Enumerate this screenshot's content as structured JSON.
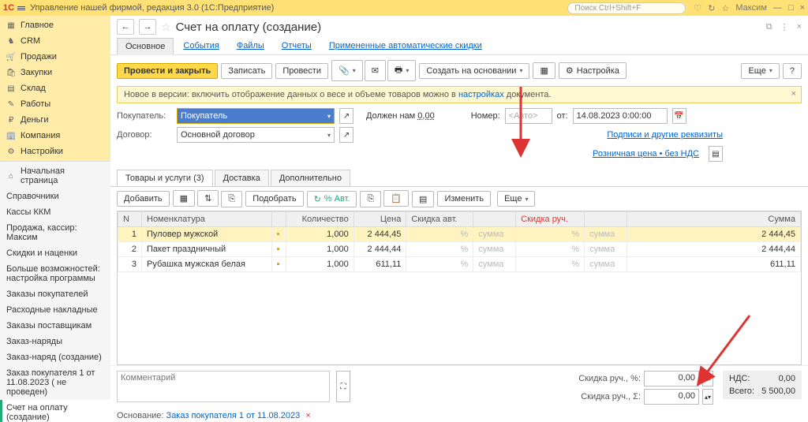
{
  "titlebar": {
    "title": "Управление нашей фирмой, редакция 3.0  (1С:Предприятие)",
    "search_ph": "Поиск Ctrl+Shift+F",
    "user": "Максим"
  },
  "sidebar": {
    "main": [
      {
        "icon": "▦",
        "label": "Главное"
      },
      {
        "icon": "♞",
        "label": "CRM"
      },
      {
        "icon": "🛒",
        "label": "Продажи"
      },
      {
        "icon": "🛍",
        "label": "Закупки"
      },
      {
        "icon": "▤",
        "label": "Склад"
      },
      {
        "icon": "✎",
        "label": "Работы"
      },
      {
        "icon": "₽",
        "label": "Деньги"
      },
      {
        "icon": "🏢",
        "label": "Компания"
      },
      {
        "icon": "⚙",
        "label": "Настройки"
      }
    ],
    "secondary": [
      "Начальная страница",
      "Справочники",
      "Кассы ККМ",
      "Продажа, кассир: Максим",
      "Скидки и наценки",
      "Больше возможностей: настройка программы",
      "Заказы покупателей",
      "Расходные накладные",
      "Заказы поставщикам",
      "Заказ-наряды",
      "Заказ-наряд (создание)",
      "Заказ покупателя 1 от 11.08.2023 ( не проведен)",
      "Счет на оплату (создание)"
    ],
    "active_index": 12,
    "home_icon": "⌂"
  },
  "doc": {
    "title": "Счет на оплату (создание)",
    "tabs": [
      "Основное",
      "События",
      "Файлы",
      "Отчеты",
      "Примененные автоматические скидки"
    ],
    "active_tab": 0,
    "toolbar": {
      "post_close": "Провести и закрыть",
      "save": "Записать",
      "post": "Провести",
      "create_based": "Создать на основании",
      "settings": "Настройка",
      "more": "Еще"
    },
    "banner": {
      "pre": "Новое в версии: включить отображение данных о весе и объеме товаров можно в ",
      "link": "настройках",
      "post": " документа."
    },
    "form": {
      "buyer_lbl": "Покупатель:",
      "buyer_val": "Покупатель",
      "debt_lbl": "Должен нам ",
      "debt_val": "0,00",
      "number_lbl": "Номер:",
      "number_ph": "<Авто>",
      "from_lbl": "от:",
      "date_val": "14.08.2023  0:00:00",
      "contract_lbl": "Договор:",
      "contract_val": "Основной договор",
      "sign_link": "Подписи и другие реквизиты",
      "price_link": "Розничная цена • без НДС"
    },
    "subtabs": [
      "Товары и услуги (3)",
      "Доставка",
      "Дополнительно"
    ],
    "active_subtab": 0,
    "gridbar": {
      "add": "Добавить",
      "pick": "Подобрать",
      "auto": "% Авт.",
      "edit": "Изменить",
      "more": "Еще"
    },
    "grid": {
      "cols": [
        "N",
        "Номенклатура",
        "",
        "Количество",
        "Цена",
        "Скидка авт.",
        "",
        "Скидка руч.",
        "",
        "Сумма"
      ],
      "rows": [
        {
          "n": "1",
          "name": "Пуловер мужской",
          "qty": "1,000",
          "price": "2 444,45",
          "da": "%",
          "dat": "сумма",
          "dm": "%",
          "dmt": "сумма",
          "sum": "2 444,45",
          "sel": true
        },
        {
          "n": "2",
          "name": "Пакет праздничный",
          "qty": "1,000",
          "price": "2 444,44",
          "da": "%",
          "dat": "сумма",
          "dm": "%",
          "dmt": "сумма",
          "sum": "2 444,44"
        },
        {
          "n": "3",
          "name": "Рубашка мужская белая",
          "qty": "1,000",
          "price": "611,11",
          "da": "%",
          "dat": "сумма",
          "dm": "%",
          "dmt": "сумма",
          "sum": "611,11"
        }
      ]
    },
    "footer": {
      "comment_ph": "Комментарий",
      "disc_pct_lbl": "Скидка руч., %:",
      "disc_pct_val": "0,00",
      "disc_sum_lbl": "Скидка руч., Σ:",
      "disc_sum_val": "0,00",
      "nds_lbl": "НДС:",
      "nds_val": "0,00",
      "total_lbl": "Всего:",
      "total_val": "5 500,00",
      "basis_lbl": "Основание: ",
      "basis_link": "Заказ покупателя 1 от 11.08.2023"
    }
  }
}
